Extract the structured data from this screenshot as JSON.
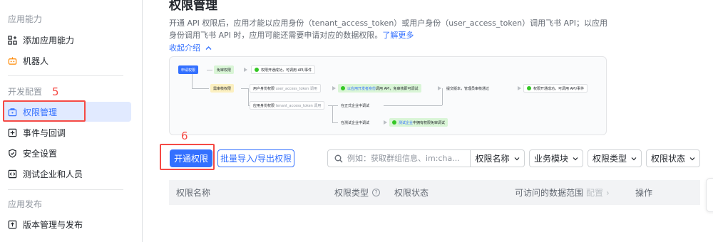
{
  "sidebar": {
    "sections": [
      {
        "title": "应用能力",
        "items": [
          {
            "label": "添加应用能力",
            "icon": "grid-plus-icon"
          },
          {
            "label": "机器人",
            "icon": "robot-icon"
          }
        ]
      },
      {
        "title": "开发配置",
        "items": [
          {
            "label": "权限管理",
            "icon": "permission-icon",
            "active": true
          },
          {
            "label": "事件与回调",
            "icon": "event-icon"
          },
          {
            "label": "安全设置",
            "icon": "shield-icon"
          },
          {
            "label": "测试企业和人员",
            "icon": "code-icon"
          }
        ]
      },
      {
        "title": "应用发布",
        "items": [
          {
            "label": "版本管理与发布",
            "icon": "upload-icon"
          }
        ]
      }
    ],
    "annotation_5": "5"
  },
  "main": {
    "title": "权限管理",
    "description": "开通 API 权限后，应用才能以应用身份（tenant_access_token）或用户身份（user_access_token）调用飞书 API；以应用身份调用飞书 API 时，应用可能还需要申请对应的数据权限。",
    "learn_more": "了解更多",
    "collapse_label": "收起介绍",
    "flow": {
      "apply": "申请权限",
      "no_review": "免审权限",
      "enabled_direct": "权限开通成功，可调用 API/事件",
      "need_review": "需审核权限",
      "user_scope": "用户身份权限",
      "user_token": "user_access_token 调用",
      "dev_call_prefix": "以应用开发者身份",
      "dev_call_suffix": "调用 API，免审核即可调试",
      "submit": "提交版本，管理员审核通过",
      "enabled_after": "权限开通成功，可调用 API/事件",
      "app_scope": "应用身份权限",
      "tenant_token": "tenant_access_token 调用",
      "prod_debug": "在正式企业中调试",
      "test_debug": "在测试企业中调试",
      "test_result_prefix": "测试企业",
      "test_result_suffix": "中拥有权限免审调试"
    },
    "toolbar": {
      "enable_button": "开通权限",
      "bulk_button": "批量导入/导出权限",
      "search_placeholder": "例如：获取群组信息、im:cha...",
      "filters": [
        "权限名称",
        "业务模块",
        "权限类型",
        "权限状态"
      ]
    },
    "table": {
      "columns": [
        "权限名称",
        "权限类型",
        "权限状态",
        "可访问的数据范围",
        "操作"
      ],
      "config_label": "配置"
    },
    "annotation_6": "6"
  },
  "colors": {
    "accent": "#3370ff",
    "annotation": "#f54a45",
    "success": "#34c724"
  }
}
